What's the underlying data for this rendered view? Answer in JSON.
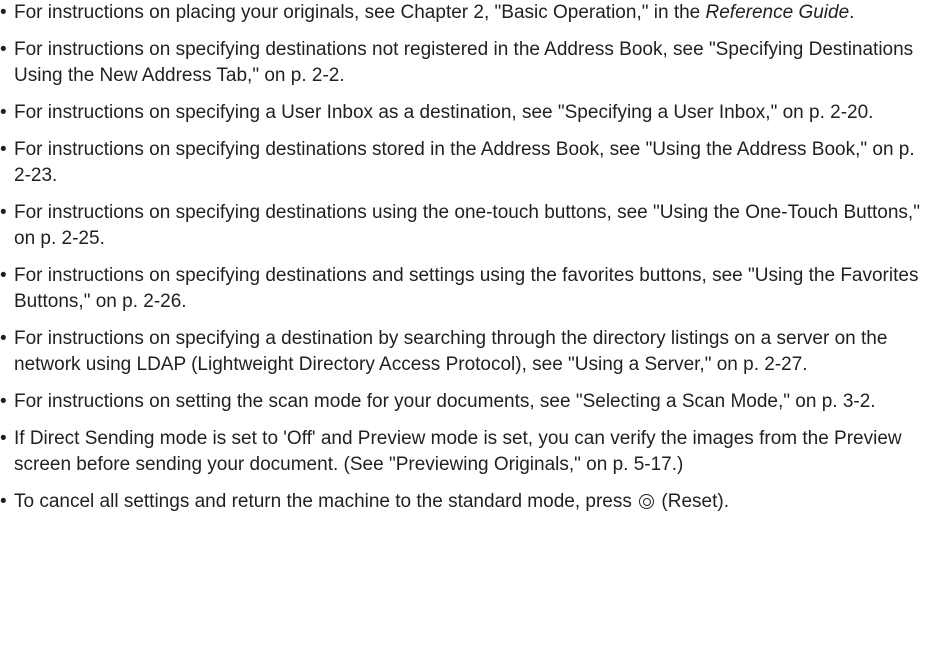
{
  "bullet_glyph": "•",
  "items": [
    {
      "a": "For instructions on placing your originals, see Chapter 2, \"Basic Operation,\" in the ",
      "em": "Reference Guide",
      "b": "."
    },
    {
      "text": "For instructions on specifying destinations not registered in the Address Book, see \"Specifying Destinations Using the New Address Tab,\" on p. 2-2."
    },
    {
      "text": "For instructions on specifying a User Inbox as a destination, see \"Specifying a User Inbox,\" on p. 2-20."
    },
    {
      "text": "For instructions on specifying destinations stored in the Address Book, see \"Using the Address Book,\" on p. 2-23."
    },
    {
      "text": "For instructions on specifying destinations using the one-touch buttons, see \"Using the One-Touch Buttons,\" on p. 2-25."
    },
    {
      "text": "For instructions on specifying destinations and settings using the favorites buttons, see \"Using the Favorites Buttons,\" on p. 2-26."
    },
    {
      "text": "For instructions on specifying a destination by searching through the directory listings on a server on the network using LDAP (Lightweight Directory Access Protocol), see \"Using a Server,\" on p. 2-27."
    },
    {
      "text": "For instructions on setting the scan mode for your documents, see \"Selecting a Scan Mode,\" on p. 3-2."
    },
    {
      "text": "If Direct Sending mode is set to 'Off' and Preview mode is set, you can verify the images from the Preview screen before sending your document. (See \"Previewing Originals,\" on p. 5-17.)"
    },
    {
      "a": "To cancel all settings and return the machine to the standard mode, press ",
      "icon": "reset-key-icon",
      "b": " (Reset)."
    }
  ]
}
